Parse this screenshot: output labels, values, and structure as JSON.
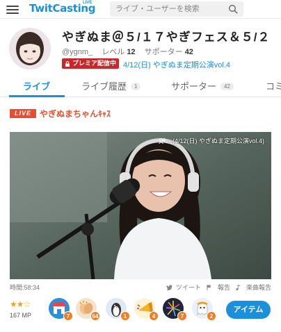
{
  "header": {
    "logo": "TwitCasting",
    "logo_sub": "LIVE",
    "search_placeholder": "ライブ・ユーザーを検索"
  },
  "profile": {
    "title": "やぎぬま＠５/１７やぎフェス＆５/２",
    "user_id": "@ygnm_",
    "level_label": "レベル",
    "level_value": "12",
    "supporter_label": "サポーター",
    "supporter_value": "42",
    "premium_badge": "プレミア配信中",
    "event_link": "4/12(日) やぎぬま定期公演vol.4"
  },
  "tabs": [
    {
      "label": "ライブ",
      "count": ""
    },
    {
      "label": "ライブ履歴",
      "count": "1"
    },
    {
      "label": "サポーター",
      "count": "42"
    },
    {
      "label": "コミ",
      "count": ""
    }
  ],
  "live": {
    "badge": "LIVE",
    "title": "やぎぬまちゃんｷｬｽ",
    "overlay": "- (4/12(日) やぎぬま定期公演vol.4)"
  },
  "footer": {
    "time": "時間:58:34",
    "tweet": "ツイート",
    "report": "報告",
    "music_report": "楽曲報告",
    "stars": "★★☆",
    "mp": "167 MP",
    "item_button": "アイテム",
    "items": [
      {
        "name": "store-icon",
        "count": "7"
      },
      {
        "name": "clap-icon",
        "count": "64"
      },
      {
        "name": "penguin-icon",
        "count": "1"
      },
      {
        "name": "horn-icon",
        "count": "4"
      },
      {
        "name": "firework-icon",
        "count": "7"
      },
      {
        "name": "ghost-icon",
        "count": "2"
      }
    ]
  },
  "colors": {
    "accent": "#1b8fd9",
    "live": "#e2512f",
    "premium": "#c82828",
    "badge_count": "#f07e26"
  }
}
